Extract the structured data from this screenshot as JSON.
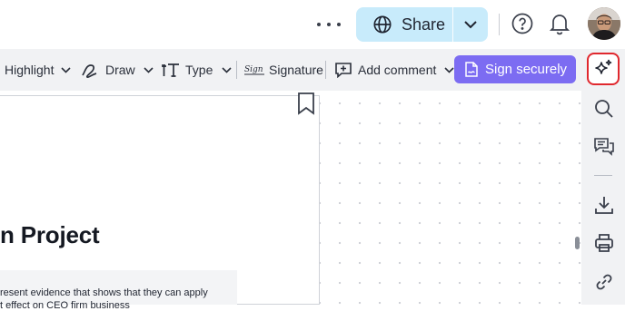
{
  "header": {
    "more_menu": "more options",
    "share_label": "Share",
    "help_icon": "help-circle-icon",
    "notifications_icon": "bell-icon",
    "avatar_alt": "user avatar"
  },
  "toolbar": {
    "highlight_label": "Highlight",
    "draw_label": "Draw",
    "type_label": "Type",
    "signature_label": "Signature",
    "signature_glyph_text": "Sign",
    "add_comment_label": "Add comment",
    "sign_securely_label": "Sign securely"
  },
  "rail": {
    "items": [
      "ai-sparkle-icon",
      "search-icon",
      "comments-icon",
      "download-icon",
      "print-icon",
      "link-icon"
    ]
  },
  "document": {
    "heading": "n Project",
    "body_line1": "resent evidence that shows that they can apply",
    "body_line2": "t effect on CEO firm business"
  },
  "colors": {
    "accent": "#7c6cf2",
    "share_bg": "#c8ebfb",
    "toolbar_bg": "#f1f2f4",
    "highlight_outline": "#e0282e"
  }
}
